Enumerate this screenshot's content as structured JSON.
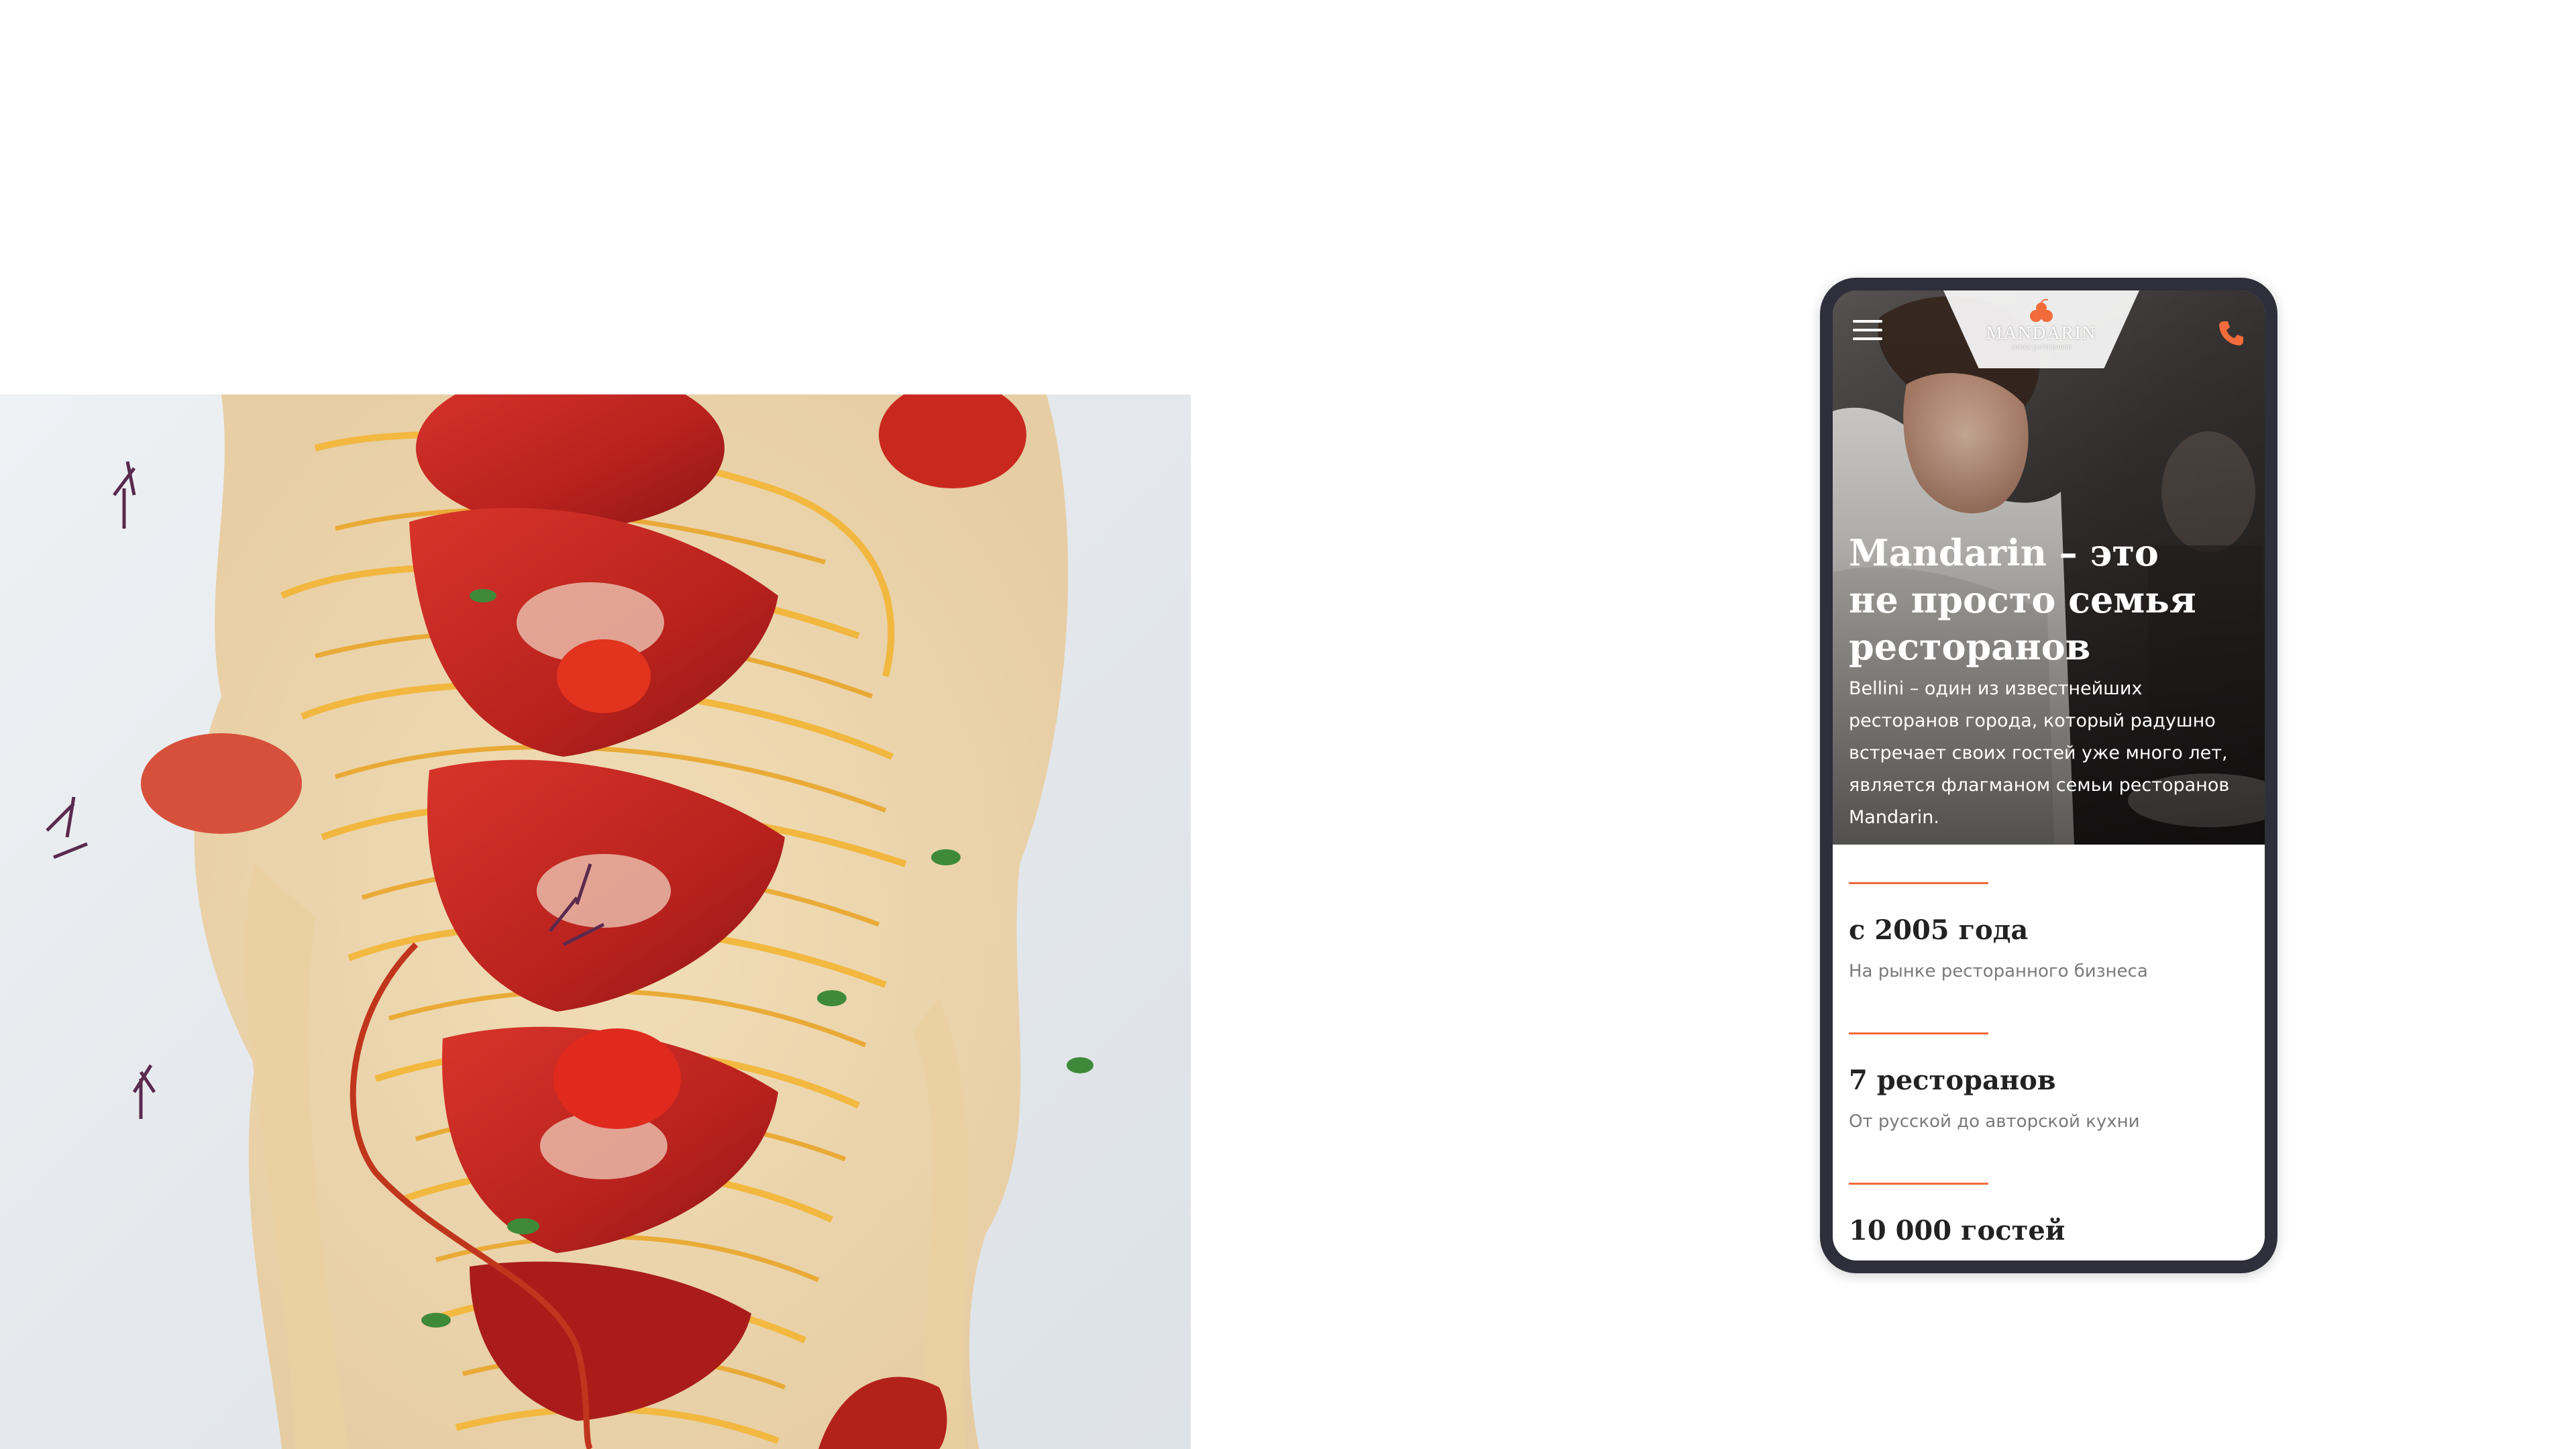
{
  "food_photo": {
    "alt": "Паста с лобстером"
  },
  "phone": {
    "header": {
      "menu_icon": "hamburger-menu-icon",
      "logo": {
        "name": "MANDARIN",
        "subtitle": "семья ресторанов"
      },
      "phone_icon": "phone-icon",
      "accent_color": "#f26b3a"
    },
    "hero": {
      "title": "Mandarin – это не просто семья ресторанов",
      "text": "Bellini – один из известнейших ресторанов города, который радушно встречает своих гостей уже много лет, является флагманом семьи ресторанов Mandarin."
    },
    "stats": [
      {
        "value": "с 2005 года",
        "description": "На рынке ресторанного бизнеса"
      },
      {
        "value": "7 ресторанов",
        "description": "От русской до авторской кухни"
      },
      {
        "value": "10 000 гостей",
        "description": ""
      }
    ]
  }
}
